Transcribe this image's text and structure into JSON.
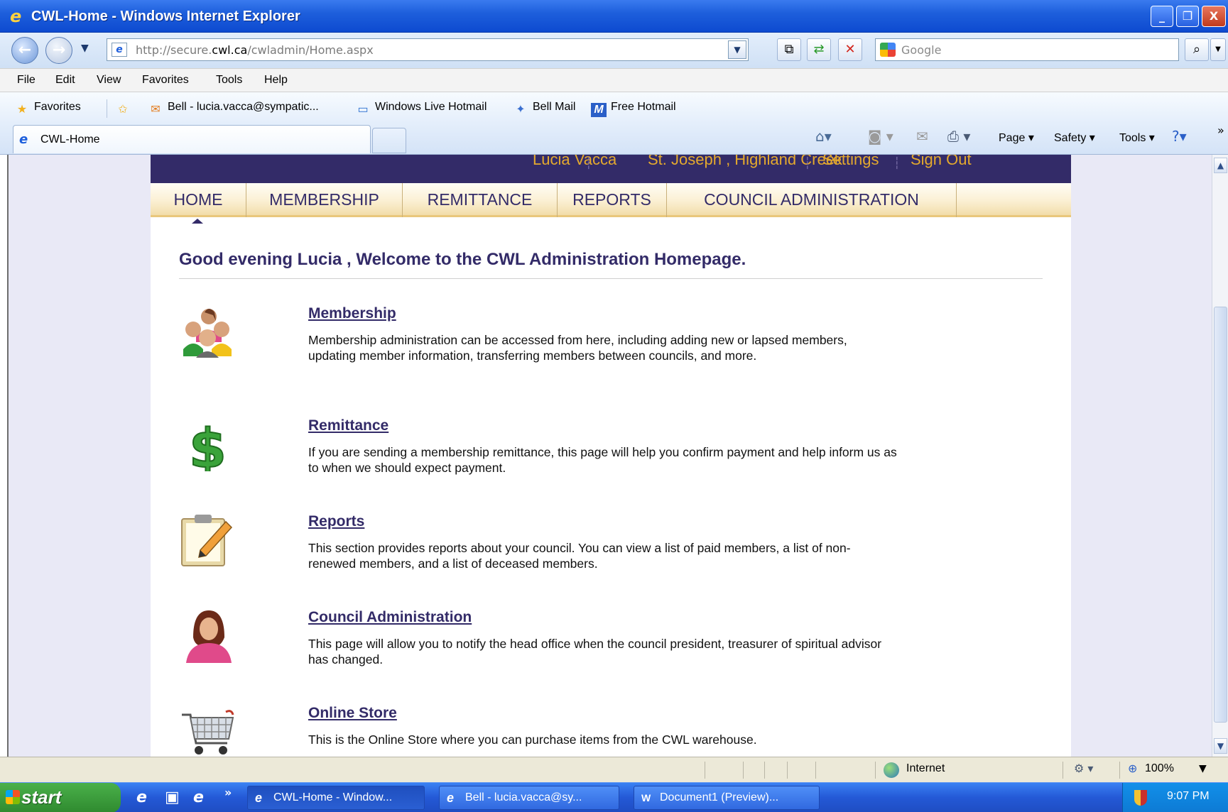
{
  "window": {
    "title": "CWL-Home - Windows Internet Explorer",
    "minimize": "_",
    "restore": "❐",
    "close": "X"
  },
  "address": {
    "url_prefix": "http://secure.",
    "url_domain": "cwl.ca",
    "url_path": "/cwladmin/Home.aspx"
  },
  "search": {
    "placeholder": "Google"
  },
  "menu": [
    "File",
    "Edit",
    "View",
    "Favorites",
    "Tools",
    "Help"
  ],
  "favorites_bar": {
    "favorites_label": "Favorites",
    "links": [
      {
        "label": "Bell - lucia.vacca@sympatic...",
        "icon": "mail-icon"
      },
      {
        "label": "Windows Live Hotmail",
        "icon": "hotmail-icon"
      },
      {
        "label": "Bell Mail",
        "icon": "bell-mail-icon"
      },
      {
        "label": "Free Hotmail",
        "icon": "msn-icon"
      }
    ]
  },
  "tab": {
    "label": "CWL-Home"
  },
  "command_bar": [
    "Page ▾",
    "Safety ▾",
    "Tools ▾"
  ],
  "site": {
    "user_bar": [
      "Lucia Vacca",
      "St. Joseph , Highland Creek",
      "Settings",
      "Sign Out"
    ],
    "nav": [
      "HOME",
      "MEMBERSHIP",
      "REMITTANCE",
      "REPORTS",
      "COUNCIL ADMINISTRATION"
    ],
    "welcome": "Good evening Lucia , Welcome to the CWL Administration Homepage.",
    "sections": [
      {
        "title": "Membership",
        "icon": "people-group-icon",
        "text": "Membership administration can be accessed from here, including adding new or lapsed members, updating member information, transferring members between councils, and more."
      },
      {
        "title": "Remittance",
        "icon": "dollar-sign-icon",
        "text": "If you are sending a membership remittance, this page will help you confirm payment and help inform us as to when we should expect payment."
      },
      {
        "title": "Reports",
        "icon": "clipboard-pencil-icon",
        "text": "This section provides reports about your council. You can view a list of paid members, a list of non-renewed members, and a list of deceased members."
      },
      {
        "title": "Council Administration",
        "icon": "woman-user-icon",
        "text": "This page will allow you to notify the head office when the council president, treasurer of spiritual advisor has changed."
      },
      {
        "title": "Online Store",
        "icon": "shopping-cart-icon",
        "text": "This is the Online Store where you can purchase items from the CWL warehouse."
      }
    ]
  },
  "status": {
    "zone": "Internet",
    "zoom": "100%"
  },
  "taskbar": {
    "start": "start",
    "tasks": [
      "CWL-Home - Window...",
      "Bell - lucia.vacca@sy...",
      "Document1 (Preview)..."
    ],
    "clock": "9:07 PM"
  },
  "colors": {
    "site_purple": "#332b68",
    "gold_text": "#e4a92e",
    "xp_blue": "#1e5fdc"
  }
}
